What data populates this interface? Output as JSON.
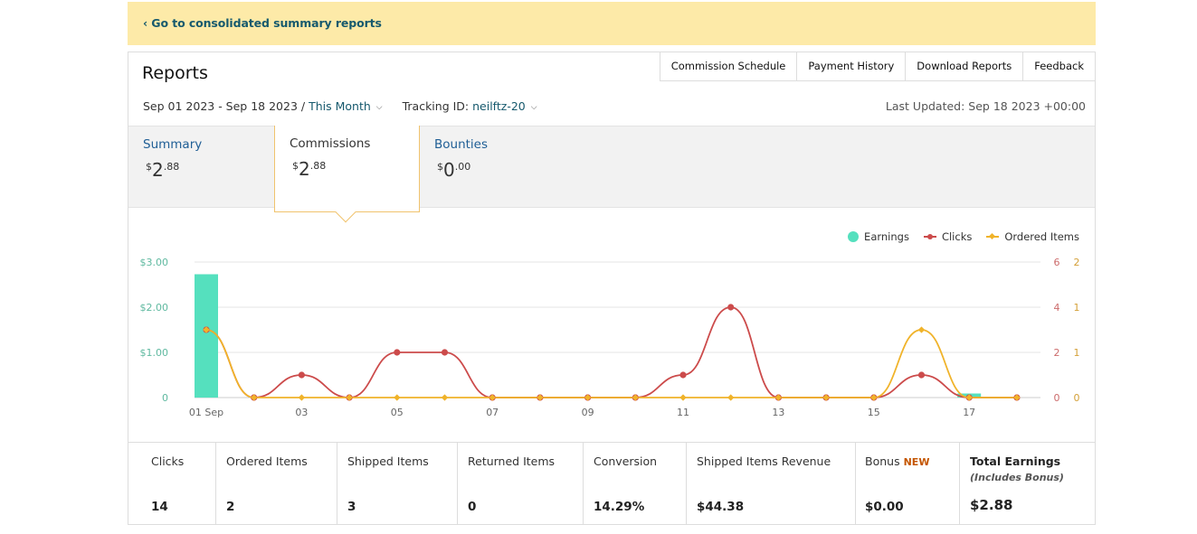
{
  "banner": {
    "link": "‹ Go to consolidated summary reports"
  },
  "header": {
    "title": "Reports",
    "links": [
      "Commission Schedule",
      "Payment History",
      "Download Reports",
      "Feedback"
    ],
    "date_range": "Sep 01 2023 - Sep 18 2023 /",
    "period": "This Month",
    "tracking_label": "Tracking ID:",
    "tracking_id": "neilftz-20",
    "last_updated": "Last Updated: Sep 18 2023 +00:00"
  },
  "tabs": [
    {
      "label": "Summary",
      "currency": "$",
      "whole": "2",
      "cents": ".88"
    },
    {
      "label": "Commissions",
      "currency": "$",
      "whole": "2",
      "cents": ".88"
    },
    {
      "label": "Bounties",
      "currency": "$",
      "whole": "0",
      "cents": ".00"
    }
  ],
  "legend": {
    "earnings": "Earnings",
    "clicks": "Clicks",
    "ordered": "Ordered Items"
  },
  "chart_data": {
    "type": "bar",
    "x": [
      "01 Sep",
      "02",
      "03",
      "04",
      "05",
      "06",
      "07",
      "08",
      "09",
      "10",
      "11",
      "12",
      "13",
      "14",
      "15",
      "16",
      "17",
      "18"
    ],
    "x_tick_labels": [
      "01 Sep",
      "03",
      "05",
      "07",
      "09",
      "11",
      "13",
      "15",
      "17"
    ],
    "y_left_ticks": [
      "$3.00",
      "$2.00",
      "$1.00",
      "0"
    ],
    "y_clicks_ticks": [
      "6",
      "4",
      "2",
      "0"
    ],
    "y_ordered_ticks": [
      "2",
      "1",
      "1",
      "0"
    ],
    "ylim_left": [
      0,
      3
    ],
    "ylim_clicks": [
      0,
      6
    ],
    "ylim_ordered": [
      0,
      2
    ],
    "grid": true,
    "legend_position": "top-right",
    "series": [
      {
        "name": "Earnings",
        "type": "bar",
        "color": "#55e0be",
        "axis": "left",
        "values": [
          2.73,
          0,
          0,
          0,
          0,
          0,
          0,
          0,
          0,
          0,
          0,
          0,
          0,
          0,
          0,
          0,
          0.09,
          0
        ]
      },
      {
        "name": "Clicks",
        "type": "line",
        "color": "#cc4b4b",
        "axis": "clicks",
        "values": [
          3,
          0,
          1,
          0,
          2,
          2,
          0,
          0,
          0,
          0,
          1,
          4,
          0,
          0,
          0,
          1,
          0,
          0
        ]
      },
      {
        "name": "Ordered Items",
        "type": "line",
        "color": "#f0b32a",
        "axis": "ordered",
        "values": [
          1,
          0,
          0,
          0,
          0,
          0,
          0,
          0,
          0,
          0,
          0,
          0,
          0,
          0,
          0,
          1,
          0,
          0
        ]
      }
    ]
  },
  "stats": [
    {
      "label": "Clicks",
      "value": "14"
    },
    {
      "label": "Ordered Items",
      "value": "2"
    },
    {
      "label": "Shipped Items",
      "value": "3"
    },
    {
      "label": "Returned Items",
      "value": "0"
    },
    {
      "label": "Conversion",
      "value": "14.29%"
    },
    {
      "label": "Shipped Items Revenue",
      "value": "$44.38"
    },
    {
      "label": "Bonus",
      "badge": "NEW",
      "value": "$0.00"
    },
    {
      "label": "Total Earnings",
      "sub": "(Includes Bonus)",
      "value": "$2.88"
    }
  ]
}
